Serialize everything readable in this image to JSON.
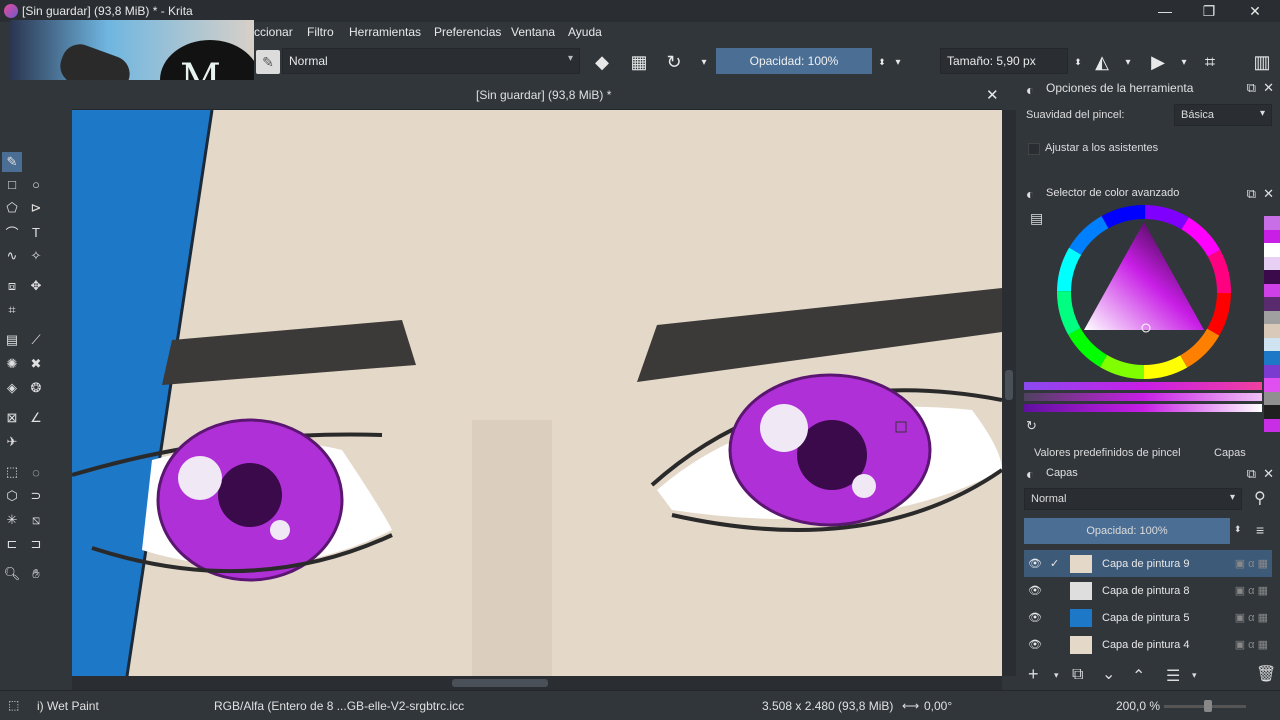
{
  "window": {
    "title": "[Sin guardar]  (93,8 MiB) * - Krita",
    "controls": [
      "—",
      "❐",
      "✕"
    ]
  },
  "menu": {
    "items": [
      "ccionar",
      "Filtro",
      "Herramientas",
      "Preferencias",
      "Ventana",
      "Ayuda"
    ]
  },
  "toolbar": {
    "blend_mode": "Normal",
    "opacity": "Opacidad: 100%",
    "size": "Tamaño: 5,90 px"
  },
  "canvas": {
    "tab_title": "[Sin guardar]  (93,8 MiB) *",
    "close": "✕"
  },
  "tool_options": {
    "title": "Opciones de la herramienta",
    "smoothing_label": "Suavidad del pincel:",
    "smoothing_value": "Básica",
    "snap_label": "Ajustar a los asistentes"
  },
  "color_selector": {
    "title": "Selector de color avanzado",
    "palette": [
      "#c86ee6",
      "#c81ee6",
      "#ffffff",
      "#e8d0f5",
      "#3a0a4a",
      "#d040e8",
      "#5a2a6e",
      "#a0a0a0",
      "#d9c9b8",
      "#cfe4f0",
      "#1e78c8",
      "#7c3bd0",
      "#e050f0",
      "#909090",
      "#202020",
      "#c82ee6"
    ]
  },
  "layers_docker": {
    "tab_presets": "Valores predefinidos de pincel",
    "tab_layers": "Capas",
    "title": "Capas",
    "blend_mode": "Normal",
    "opacity": "Opacidad:  100%",
    "layers": [
      {
        "name": "Capa de pintura 9",
        "active": true
      },
      {
        "name": "Capa de pintura 8",
        "active": false
      },
      {
        "name": "Capa de pintura 5",
        "active": false
      },
      {
        "name": "Capa de pintura 4",
        "active": false
      }
    ]
  },
  "status": {
    "brush": "i) Wet Paint",
    "color_profile": "RGB/Alfa (Entero de 8 ...GB-elle-V2-srgbtrc.icc",
    "dimensions": "3.508 x 2.480 (93,8 MiB)",
    "rotation": "0,00°",
    "zoom": "200,0 %"
  },
  "colors": {
    "accent": "#4b6e95",
    "skin": "#e4d8c9",
    "eye": "#b030d8",
    "blue_band": "#1e78c8"
  }
}
